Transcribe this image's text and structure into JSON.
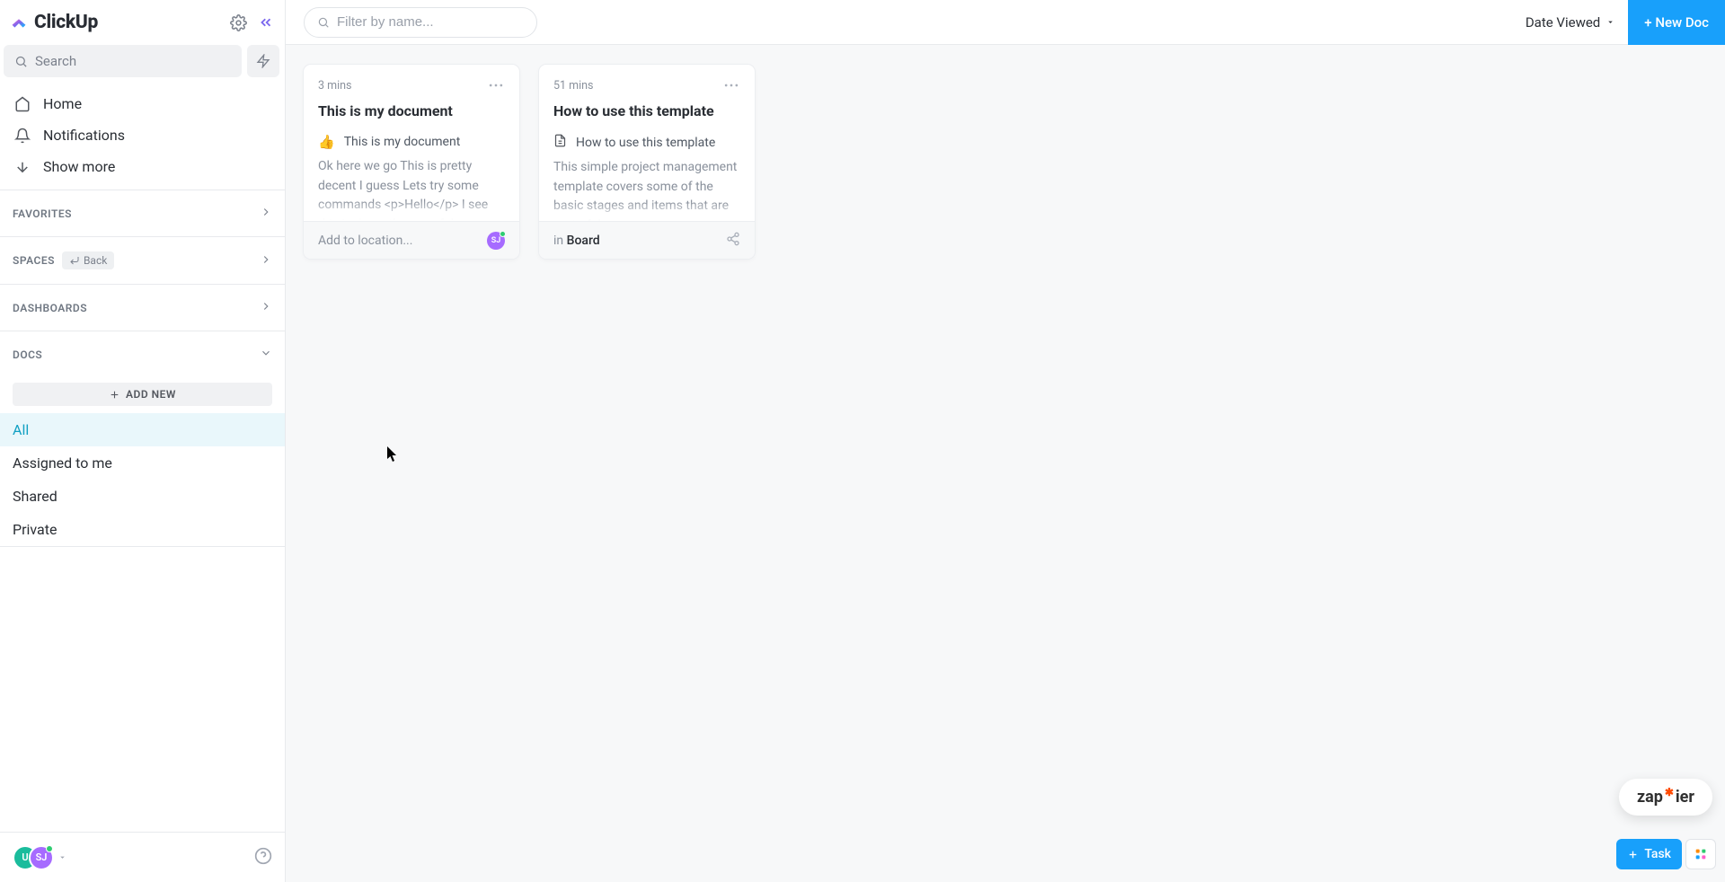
{
  "brand": {
    "name": "ClickUp"
  },
  "sidebar": {
    "search_placeholder": "Search",
    "nav": [
      {
        "label": "Home"
      },
      {
        "label": "Notifications"
      },
      {
        "label": "Show more"
      }
    ],
    "sections": {
      "favorites": {
        "title": "FAVORITES"
      },
      "spaces": {
        "title": "SPACES",
        "back_label": "Back"
      },
      "dashboards": {
        "title": "DASHBOARDS"
      },
      "docs": {
        "title": "DOCS",
        "add_new_label": "ADD NEW",
        "filters": [
          {
            "label": "All",
            "active": true
          },
          {
            "label": "Assigned to me",
            "active": false
          },
          {
            "label": "Shared",
            "active": false
          },
          {
            "label": "Private",
            "active": false
          }
        ]
      }
    },
    "footer_avatars": [
      {
        "initials": "U",
        "color": "teal"
      },
      {
        "initials": "SJ",
        "color": "purple"
      }
    ]
  },
  "topbar": {
    "filter_placeholder": "Filter by name...",
    "sort_label": "Date Viewed",
    "new_doc_label": "+ New Doc"
  },
  "docs": [
    {
      "time": "3 mins",
      "title": "This is my document",
      "sub_icon": "👍",
      "sub_label": "This is my document",
      "preview": "Ok here we go This is pretty decent I guess Lets try some commands <p>Hello</p> I see this is decently powerful.",
      "footer_mode": "add",
      "footer_text": "Add to location...",
      "footer_board": "",
      "avatar": "SJ"
    },
    {
      "time": "51 mins",
      "title": "How to use this template",
      "sub_icon": "doc",
      "sub_label": "How to use this template",
      "preview": "This simple project management template covers some of the basic stages and items that are part of the",
      "footer_mode": "board",
      "footer_text": "in ",
      "footer_board": "Board",
      "avatar": ""
    }
  ],
  "floating": {
    "zapier": "zapier",
    "task_label": "Task"
  }
}
